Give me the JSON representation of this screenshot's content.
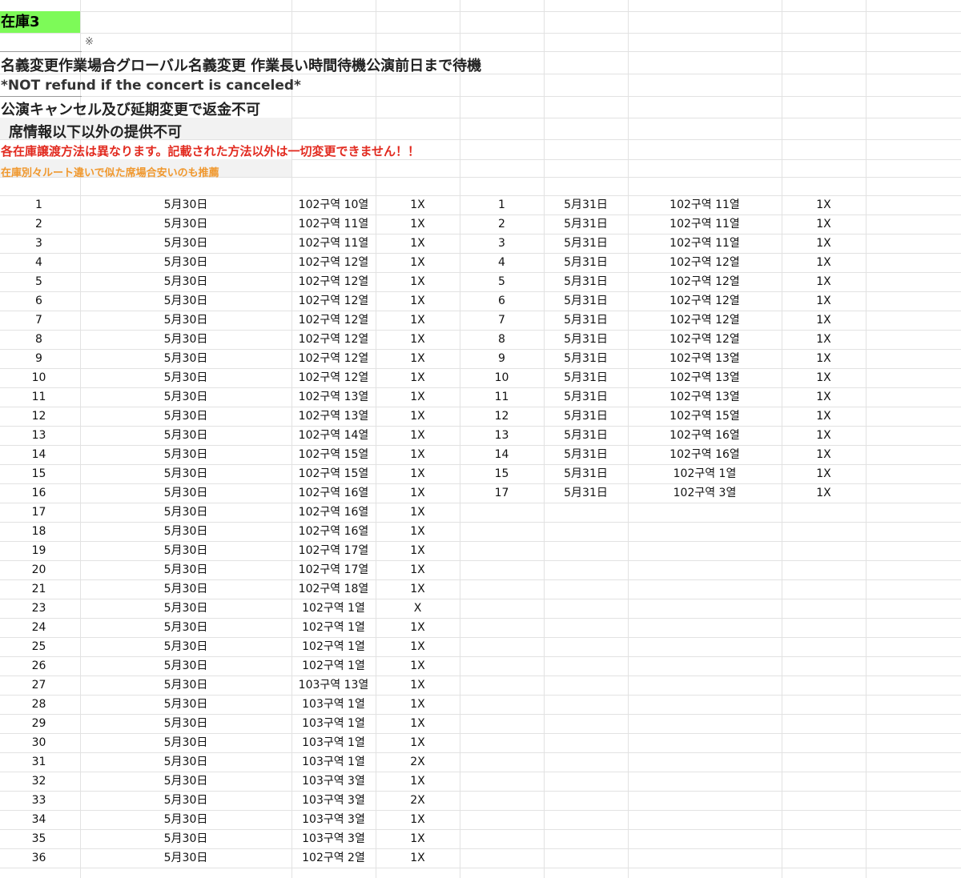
{
  "sheet_title": "在庫3",
  "asterisk": "※",
  "notes": {
    "line1": "名義変更作業場合グローバル名義変更 作業長い時間待機公演前日まで待機",
    "line2": "*NOT refund if the concert is canceled*",
    "line3": "公演キャンセル及び延期変更で返金不可",
    "line4": "席情報以下以外の提供不可",
    "line5": "各在庫譲渡方法は異なります。記載された方法以外は一切変更できません！！",
    "line6": "在庫別々ルート違いで似た席場合安いのも推薦"
  },
  "colors": {
    "title_bg": "#7dfa58",
    "red_text": "#e22b20",
    "orange_text": "#f0982e"
  },
  "table_left": {
    "rows": [
      [
        "1",
        "5月30日",
        "102구역 10열",
        "1X"
      ],
      [
        "2",
        "5月30日",
        "102구역 11열",
        "1X"
      ],
      [
        "3",
        "5月30日",
        "102구역 11열",
        "1X"
      ],
      [
        "4",
        "5月30日",
        "102구역 12열",
        "1X"
      ],
      [
        "5",
        "5月30日",
        "102구역 12열",
        "1X"
      ],
      [
        "6",
        "5月30日",
        "102구역 12열",
        "1X"
      ],
      [
        "7",
        "5月30日",
        "102구역 12열",
        "1X"
      ],
      [
        "8",
        "5月30日",
        "102구역 12열",
        "1X"
      ],
      [
        "9",
        "5月30日",
        "102구역 12열",
        "1X"
      ],
      [
        "10",
        "5月30日",
        "102구역 12열",
        "1X"
      ],
      [
        "11",
        "5月30日",
        "102구역 13열",
        "1X"
      ],
      [
        "12",
        "5月30日",
        "102구역 13열",
        "1X"
      ],
      [
        "13",
        "5月30日",
        "102구역 14열",
        "1X"
      ],
      [
        "14",
        "5月30日",
        "102구역 15열",
        "1X"
      ],
      [
        "15",
        "5月30日",
        "102구역 15열",
        "1X"
      ],
      [
        "16",
        "5月30日",
        "102구역 16열",
        "1X"
      ],
      [
        "17",
        "5月30日",
        "102구역 16열",
        "1X"
      ],
      [
        "18",
        "5月30日",
        "102구역 16열",
        "1X"
      ],
      [
        "19",
        "5月30日",
        "102구역 17열",
        "1X"
      ],
      [
        "20",
        "5月30日",
        "102구역 17열",
        "1X"
      ],
      [
        "21",
        "5月30日",
        "102구역 18열",
        "1X"
      ],
      [
        "23",
        "5月30日",
        "102구역 1열",
        "X"
      ],
      [
        "24",
        "5月30日",
        "102구역 1열",
        "1X"
      ],
      [
        "25",
        "5月30日",
        "102구역 1열",
        "1X"
      ],
      [
        "26",
        "5月30日",
        "102구역 1열",
        "1X"
      ],
      [
        "27",
        "5月30日",
        "103구역 13열",
        "1X"
      ],
      [
        "28",
        "5月30日",
        "103구역 1열",
        "1X"
      ],
      [
        "29",
        "5月30日",
        "103구역 1열",
        "1X"
      ],
      [
        "30",
        "5月30日",
        "103구역 1열",
        "1X"
      ],
      [
        "31",
        "5月30日",
        "103구역 1열",
        "2X"
      ],
      [
        "32",
        "5月30日",
        "103구역 3열",
        "1X"
      ],
      [
        "33",
        "5月30日",
        "103구역 3열",
        "2X"
      ],
      [
        "34",
        "5月30日",
        "103구역 3열",
        "1X"
      ],
      [
        "35",
        "5月30日",
        "103구역 3열",
        "1X"
      ],
      [
        "36",
        "5月30日",
        "102구역 2열",
        "1X"
      ]
    ]
  },
  "table_right": {
    "rows": [
      [
        "1",
        "5月31日",
        "102구역 11열",
        "1X"
      ],
      [
        "2",
        "5月31日",
        "102구역 11열",
        "1X"
      ],
      [
        "3",
        "5月31日",
        "102구역 11열",
        "1X"
      ],
      [
        "4",
        "5月31日",
        "102구역 12열",
        "1X"
      ],
      [
        "5",
        "5月31日",
        "102구역 12열",
        "1X"
      ],
      [
        "6",
        "5月31日",
        "102구역 12열",
        "1X"
      ],
      [
        "7",
        "5月31日",
        "102구역 12열",
        "1X"
      ],
      [
        "8",
        "5月31日",
        "102구역 12열",
        "1X"
      ],
      [
        "9",
        "5月31日",
        "102구역 13열",
        "1X"
      ],
      [
        "10",
        "5月31日",
        "102구역 13열",
        "1X"
      ],
      [
        "11",
        "5月31日",
        "102구역 13열",
        "1X"
      ],
      [
        "12",
        "5月31日",
        "102구역 15열",
        "1X"
      ],
      [
        "13",
        "5月31日",
        "102구역 16열",
        "1X"
      ],
      [
        "14",
        "5月31日",
        "102구역 16열",
        "1X"
      ],
      [
        "15",
        "5月31日",
        "102구역 1열",
        "1X"
      ],
      [
        "17",
        "5月31日",
        "102구역 3열",
        "1X"
      ]
    ]
  }
}
